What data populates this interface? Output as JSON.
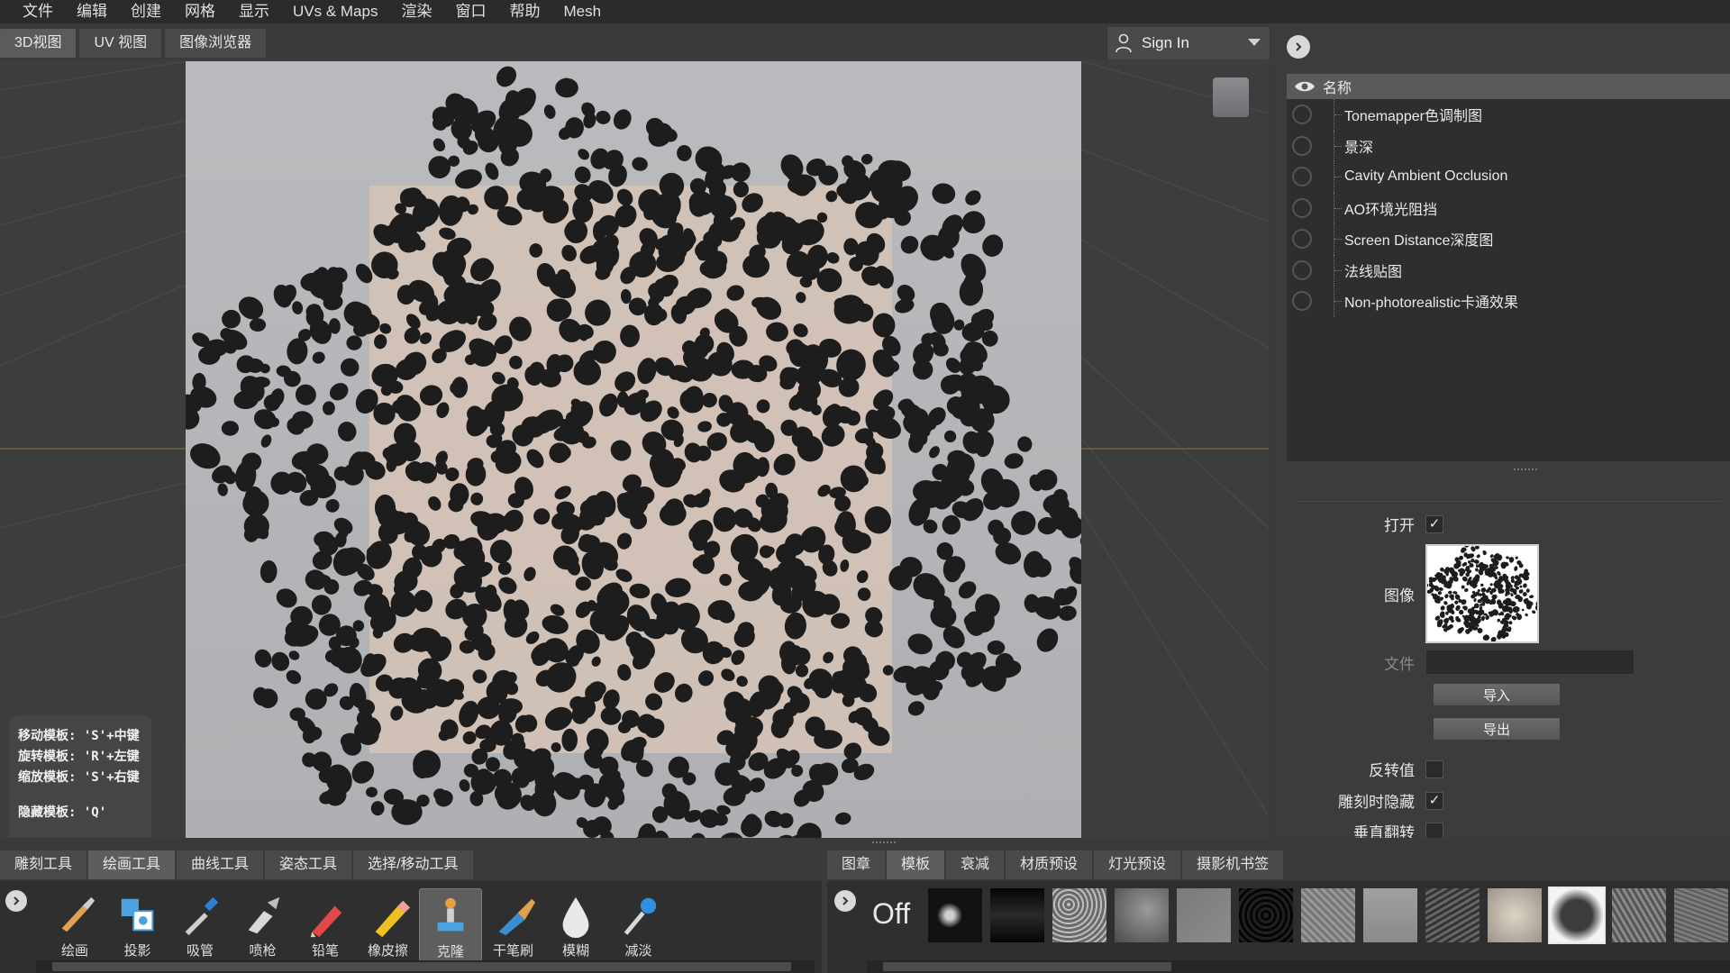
{
  "menubar": {
    "items": [
      "文件",
      "编辑",
      "创建",
      "网格",
      "显示",
      "UVs & Maps",
      "渲染",
      "窗口",
      "帮助",
      "Mesh"
    ]
  },
  "view_tabs": [
    "3D视图",
    "UV 视图",
    "图像浏览器"
  ],
  "active_view_tab": 0,
  "account": {
    "sign_in_label": "Sign In"
  },
  "viewport": {
    "hints": [
      "移动模板: 'S'+中键",
      "旋转模板: 'R'+左键",
      "缩放模板: 'S'+右键",
      "隐藏模板: 'Q'"
    ]
  },
  "layers": {
    "header": "名称",
    "items": [
      "Tonemapper色调制图",
      "景深",
      "Cavity Ambient Occlusion",
      "AO环境光阻挡",
      "Screen Distance深度图",
      "法线贴图",
      "Non-photorealistic卡通效果"
    ]
  },
  "properties": {
    "open_label": "打开",
    "open_checked": true,
    "image_label": "图像",
    "file_label": "文件",
    "file_value": "",
    "import_label": "导入",
    "export_label": "导出",
    "invert_label": "反转值",
    "invert_checked": false,
    "hide_while_sculpting_label": "雕刻时隐藏",
    "hide_while_sculpting_checked": true,
    "flip_vertical_label": "垂直翻转",
    "flip_vertical_checked": false
  },
  "tool_tabs": {
    "items": [
      "雕刻工具",
      "绘画工具",
      "曲线工具",
      "姿态工具",
      "选择/移动工具"
    ],
    "active": 1
  },
  "paint_tools": {
    "items": [
      {
        "label": "绘画",
        "icon": "paint-brush-icon"
      },
      {
        "label": "投影",
        "icon": "projection-icon"
      },
      {
        "label": "吸管",
        "icon": "eyedropper-icon"
      },
      {
        "label": "喷枪",
        "icon": "airbrush-icon"
      },
      {
        "label": "铅笔",
        "icon": "pencil-icon"
      },
      {
        "label": "橡皮擦",
        "icon": "eraser-icon"
      },
      {
        "label": "克隆",
        "icon": "stamp-icon"
      },
      {
        "label": "干笔刷",
        "icon": "dry-brush-icon"
      },
      {
        "label": "模糊",
        "icon": "blur-drop-icon"
      },
      {
        "label": "减淡",
        "icon": "dodge-icon"
      }
    ],
    "selected": 6
  },
  "tray_tabs": {
    "items": [
      "图章",
      "模板",
      "衰减",
      "材质预设",
      "灯光预设",
      "摄影机书签"
    ],
    "active": 1
  },
  "stencil_tray": {
    "off_label": "Off",
    "selected_index": 10,
    "thumbnail_count": 13
  },
  "colors": {
    "menubar_bg": "#2b2b2b",
    "panel_bg": "#3c3c3c",
    "viewport_bg": "#3d3d3d",
    "stencil_bg": "#b4b6b9",
    "spot_color": "#1d1d1d",
    "cube_face": "#d6c3b6"
  }
}
